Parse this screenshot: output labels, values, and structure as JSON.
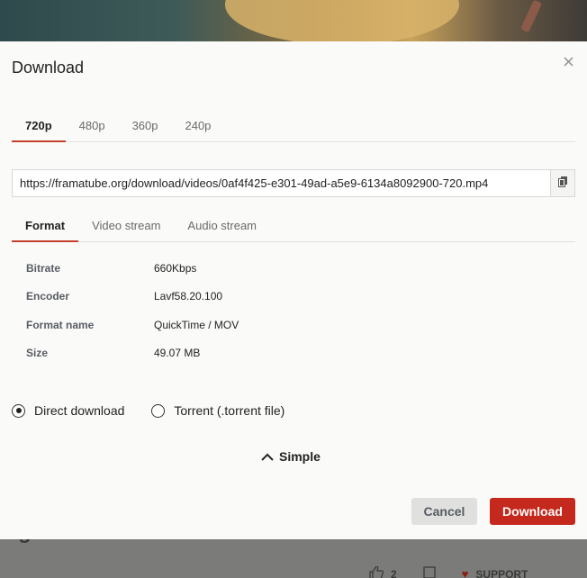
{
  "background": {
    "title_fragment": "s galdes de Framazon",
    "actions": [
      {
        "icon": "thumbs-up-icon",
        "label": "2"
      },
      {
        "icon": "save-icon",
        "label": ""
      },
      {
        "icon": "heart-icon",
        "label": "SUPPORT"
      }
    ]
  },
  "modal": {
    "title": "Download",
    "close_icon": "close-icon",
    "resolution_tabs": [
      {
        "label": "720p",
        "active": true
      },
      {
        "label": "480p",
        "active": false
      },
      {
        "label": "360p",
        "active": false
      },
      {
        "label": "240p",
        "active": false
      }
    ],
    "url": "https://framatube.org/download/videos/0af4f425-e301-49ad-a5e9-6134a8092900-720.mp4",
    "copy_icon": "copy-icon",
    "info_tabs": [
      {
        "label": "Format",
        "active": true
      },
      {
        "label": "Video stream",
        "active": false
      },
      {
        "label": "Audio stream",
        "active": false
      }
    ],
    "properties": [
      {
        "label": "Bitrate",
        "value": "660Kbps"
      },
      {
        "label": "Encoder",
        "value": "Lavf58.20.100"
      },
      {
        "label": "Format name",
        "value": "QuickTime / MOV"
      },
      {
        "label": "Size",
        "value": "49.07 MB"
      }
    ],
    "download_types": [
      {
        "label": "Direct download",
        "selected": true
      },
      {
        "label": "Torrent (.torrent file)",
        "selected": false
      }
    ],
    "advanced_toggle": {
      "label": "Simple",
      "icon": "chevron-up-icon"
    },
    "cancel_label": "Cancel",
    "download_label": "Download"
  },
  "colors": {
    "accent": "#c5281c",
    "tab_underline": "#c5402c"
  }
}
